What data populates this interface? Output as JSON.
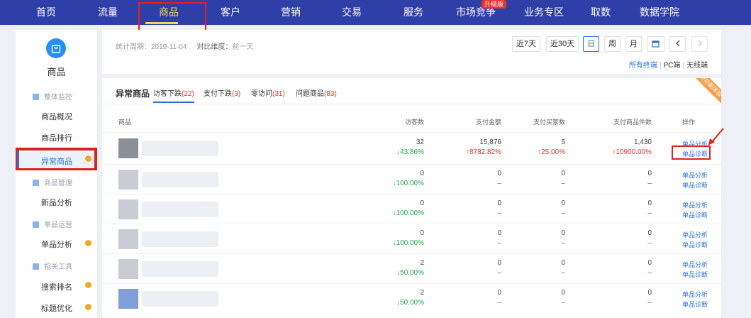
{
  "nav": {
    "items": [
      "首页",
      "流量",
      "商品",
      "客户",
      "营销",
      "交易",
      "服务",
      "市场竞争",
      "业务专区",
      "取数",
      "数据学院"
    ],
    "active": "商品",
    "upgrade_badge": "升级版",
    "colors": {
      "bar": "#2f3fa8",
      "active": "#ffd24a"
    }
  },
  "sidebar": {
    "title": "商品",
    "groups": [
      {
        "label": "整体监控",
        "items": [
          {
            "label": "商品概况",
            "dot": false
          },
          {
            "label": "商品排行",
            "dot": false
          },
          {
            "label": "异常商品",
            "dot": true,
            "active": true
          }
        ]
      },
      {
        "label": "商品管理",
        "items": [
          {
            "label": "新品分析",
            "dot": false
          }
        ]
      },
      {
        "label": "单品运营",
        "items": [
          {
            "label": "单品分析",
            "dot": true
          }
        ]
      },
      {
        "label": "相关工具",
        "items": [
          {
            "label": "搜索排名",
            "dot": true
          },
          {
            "label": "标题优化",
            "dot": true
          }
        ]
      }
    ]
  },
  "filter": {
    "period_label": "统计周期：",
    "period_value": "2019-11-04",
    "compare_label": "对比维度：",
    "compare_value": "前一天",
    "range_buttons": [
      "近7天",
      "近30天",
      "日",
      "周",
      "月"
    ],
    "active_button": "日",
    "calendar_icon": "calendar-icon",
    "prev_icon": "chevron-left-icon",
    "next_icon": "chevron-right-icon",
    "terminals": [
      "所有终端",
      "PC端",
      "无线端"
    ],
    "active_terminal": "所有终端"
  },
  "panel": {
    "title": "异常商品",
    "tabs": [
      {
        "label": "访客下跌",
        "count": "(22)"
      },
      {
        "label": "支付下跌",
        "count": "(3)"
      },
      {
        "label": "零访问",
        "count": "(31)"
      },
      {
        "label": "问题商品",
        "count": "(83)"
      }
    ],
    "ribbon": "新功能体验",
    "columns": [
      "商品",
      "访客数",
      "支付金额",
      "支付买家数",
      "支付商品件数",
      "操作"
    ],
    "rows": [
      {
        "visitors": "32",
        "visitors_chg": "43.86%",
        "visitors_dir": "down",
        "amount": "15,876",
        "amount_chg": "8782.82%",
        "amount_dir": "up",
        "buyers": "5",
        "buyers_chg": "25.00%",
        "buyers_dir": "up",
        "items": "1,430",
        "items_chg": "10900.00%",
        "items_dir": "up",
        "thumb": "dark"
      },
      {
        "visitors": "0",
        "visitors_chg": "100.00%",
        "visitors_dir": "down",
        "amount": "0",
        "amount_chg": "–",
        "buyers": "0",
        "buyers_chg": "–",
        "items": "0",
        "items_chg": "–",
        "thumb": "light"
      },
      {
        "visitors": "0",
        "visitors_chg": "100.00%",
        "visitors_dir": "down",
        "amount": "0",
        "amount_chg": "–",
        "buyers": "0",
        "buyers_chg": "–",
        "items": "0",
        "items_chg": "–",
        "thumb": "light"
      },
      {
        "visitors": "0",
        "visitors_chg": "100.00%",
        "visitors_dir": "down",
        "amount": "0",
        "amount_chg": "–",
        "buyers": "0",
        "buyers_chg": "–",
        "items": "0",
        "items_chg": "–",
        "thumb": "light"
      },
      {
        "visitors": "2",
        "visitors_chg": "50.00%",
        "visitors_dir": "down",
        "amount": "0",
        "amount_chg": "–",
        "buyers": "0",
        "buyers_chg": "–",
        "items": "0",
        "items_chg": "–",
        "thumb": "light"
      },
      {
        "visitors": "2",
        "visitors_chg": "50.00%",
        "visitors_dir": "down",
        "amount": "0",
        "amount_chg": "–",
        "buyers": "0",
        "buyers_chg": "–",
        "items": "0",
        "items_chg": "–",
        "thumb": "blue"
      }
    ],
    "op_analysis": "单品分析",
    "op_diagnosis": "单品诊断"
  }
}
